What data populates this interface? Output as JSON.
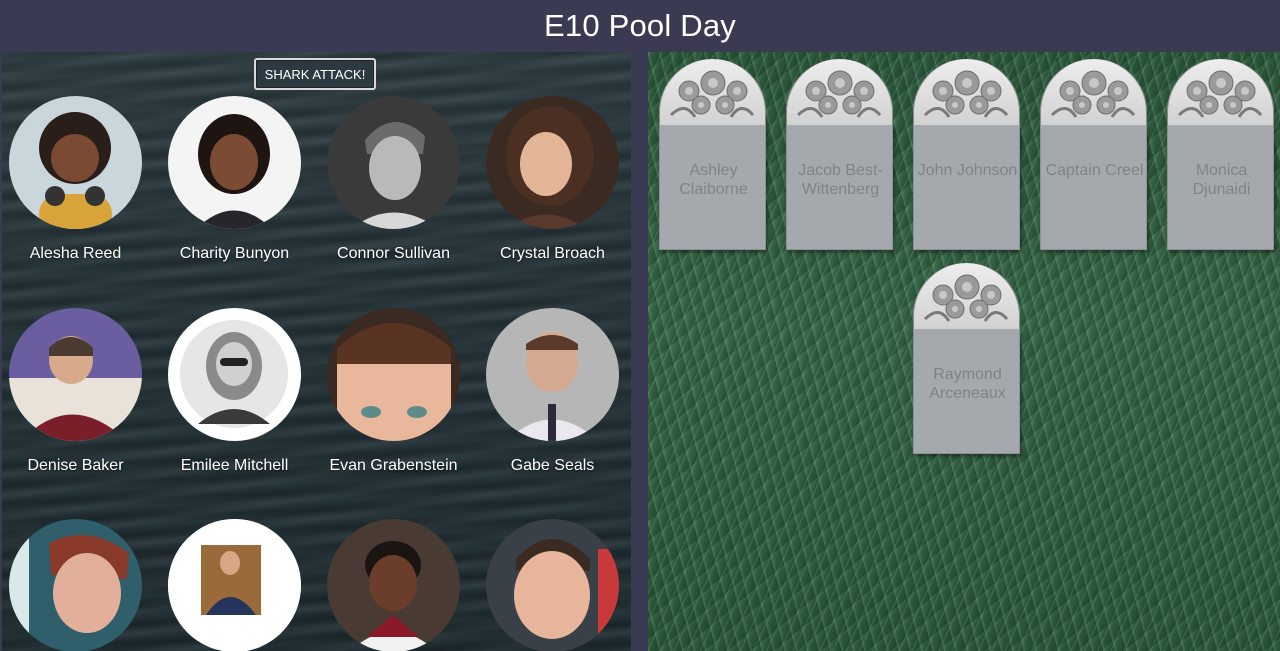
{
  "app": {
    "title": "E10 Pool Day"
  },
  "pool": {
    "shark_button": "SHARK ATTACK!",
    "swimmers": [
      {
        "name": "Alesha Reed",
        "avatar": "person-photo"
      },
      {
        "name": "Charity Bunyon",
        "avatar": "person-photo"
      },
      {
        "name": "Connor Sullivan",
        "avatar": "person-photo"
      },
      {
        "name": "Crystal Broach",
        "avatar": "person-photo"
      },
      {
        "name": "Denise Baker",
        "avatar": "person-photo"
      },
      {
        "name": "Emilee Mitchell",
        "avatar": "person-photo"
      },
      {
        "name": "Evan Grabenstein",
        "avatar": "person-photo"
      },
      {
        "name": "Gabe Seals",
        "avatar": "person-photo"
      },
      {
        "name": "",
        "avatar": "person-photo"
      },
      {
        "name": "",
        "avatar": "person-photo"
      },
      {
        "name": "",
        "avatar": "person-photo"
      },
      {
        "name": "",
        "avatar": "person-photo"
      }
    ]
  },
  "graveyard": {
    "tombstones": [
      {
        "name": "Ashley Claiborne"
      },
      {
        "name": "Jacob Best-Wittenberg"
      },
      {
        "name": "John Johnson"
      },
      {
        "name": "Captain Creel"
      },
      {
        "name": "Monica Djunaidi"
      },
      {
        "name": "Raymond Arceneaux"
      }
    ]
  },
  "colors": {
    "header_bg": "#3a3a52",
    "water": "#243338",
    "grass": "#3b6b4b",
    "stone": "#a5a8ac",
    "stone_text": "#7f8489"
  }
}
